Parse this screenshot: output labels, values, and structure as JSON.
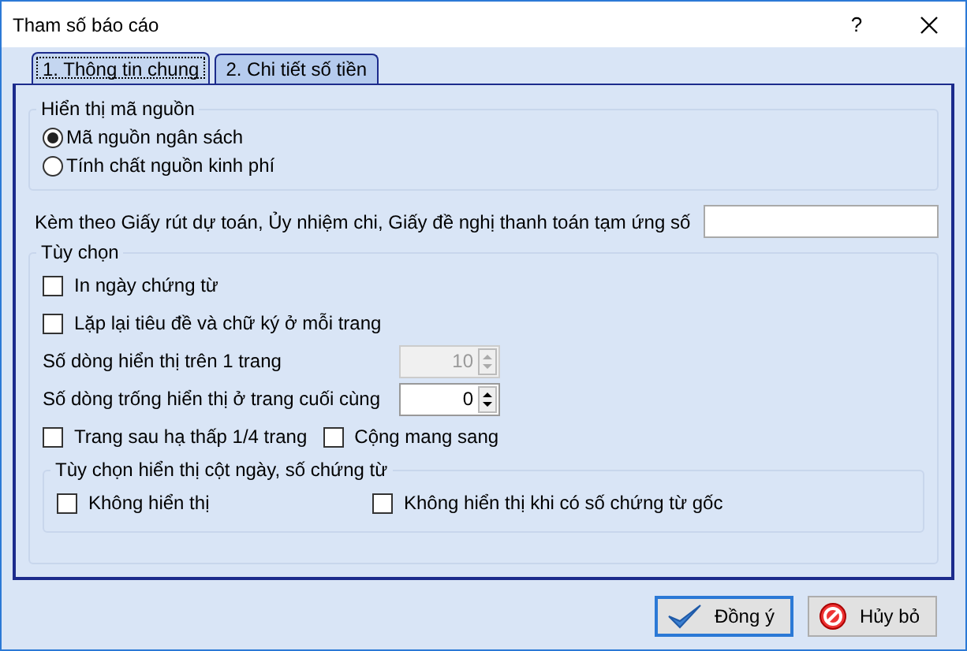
{
  "window": {
    "title": "Tham số báo cáo",
    "help": "?"
  },
  "tabs": [
    {
      "label": "1. Thông tin chung",
      "selected": true
    },
    {
      "label": "2. Chi tiết số tiền",
      "selected": false
    }
  ],
  "source_group": {
    "legend": "Hiển thị mã nguồn",
    "options": [
      {
        "label": "Mã nguồn ngân sách",
        "selected": true
      },
      {
        "label": "Tính chất nguồn kinh phí",
        "selected": false
      }
    ]
  },
  "attach": {
    "label": "Kèm theo Giấy rút dự toán, Ủy nhiệm chi, Giấy đề nghị thanh toán tạm ứng số"
  },
  "options": {
    "legend": "Tùy chọn",
    "checks": [
      {
        "label": "In ngày chứng từ",
        "checked": false
      },
      {
        "label": "Lặp lại tiêu đề và chữ ký ở mỗi trang",
        "checked": false
      }
    ],
    "spinners": [
      {
        "label": "Số dòng hiển thị trên 1 trang",
        "value": "10",
        "disabled": true
      },
      {
        "label": "Số dòng trống hiển thị ở trang cuối cùng",
        "value": "0",
        "disabled": false
      }
    ],
    "pair": [
      {
        "label": "Trang sau hạ thấp 1/4 trang",
        "checked": false
      },
      {
        "label": "Cộng mang sang",
        "checked": false
      }
    ],
    "column_group": {
      "legend": "Tùy chọn hiển thị cột ngày, số chứng từ",
      "items": [
        {
          "label": "Không hiển thị",
          "checked": false
        },
        {
          "label": "Không hiển thị khi có số chứng từ gốc",
          "checked": false
        }
      ]
    }
  },
  "buttons": [
    {
      "label": "Đồng ý",
      "kind": "ok"
    },
    {
      "label": "Hủy bỏ",
      "kind": "cancel"
    }
  ]
}
